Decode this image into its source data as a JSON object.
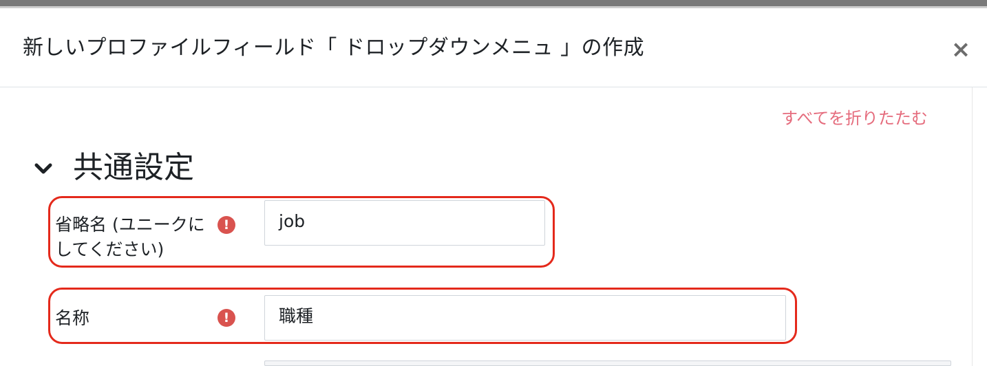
{
  "modal": {
    "title": "新しいプロファイルフィールド「 ドロップダウンメニュ 」の作成",
    "close_label": "×"
  },
  "collapse_all_link": "すべてを折りたたむ",
  "section": {
    "title": "共通設定",
    "chevron_icon": "chevron-down-icon"
  },
  "fields": {
    "shortname": {
      "label_line1": "省略名 (ユニークに",
      "label_line2": "してください)",
      "value": "job",
      "required_icon": "exclamation-circle-icon"
    },
    "name": {
      "label": "名称",
      "value": "職種",
      "required_icon": "exclamation-circle-icon"
    }
  },
  "colors": {
    "accent_link": "#e56c7d",
    "required": "#d9534f",
    "highlight": "#e4291b"
  }
}
